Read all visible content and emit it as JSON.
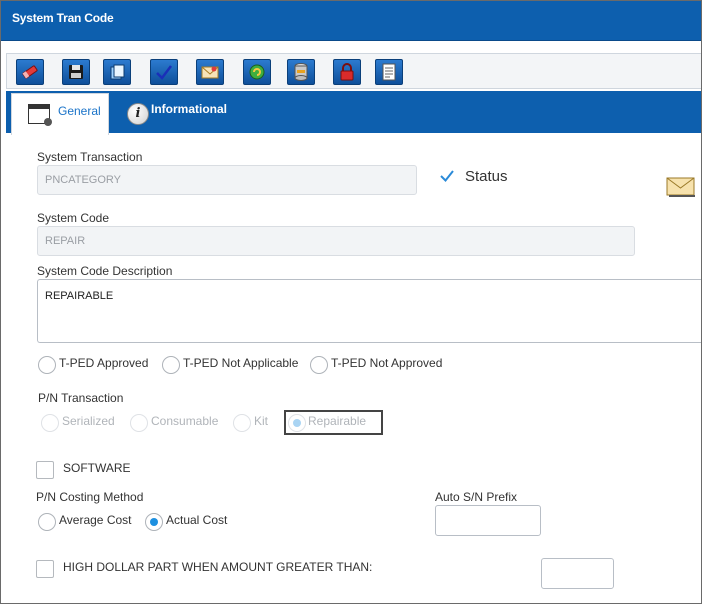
{
  "window": {
    "title": "System Tran Code"
  },
  "toolbar": {
    "buttons": [
      {
        "name": "eraser-icon"
      },
      {
        "name": "save-icon"
      },
      {
        "name": "copy-icon"
      },
      {
        "name": "checkmark-icon"
      },
      {
        "name": "mail-icon"
      },
      {
        "name": "refresh-icon"
      },
      {
        "name": "database-icon"
      },
      {
        "name": "lock-icon"
      },
      {
        "name": "report-icon"
      }
    ]
  },
  "tabs": [
    {
      "label": "General",
      "active": true
    },
    {
      "label": "Informational",
      "active": false
    }
  ],
  "form": {
    "system_transaction": {
      "label": "System Transaction",
      "value": "PNCATEGORY"
    },
    "status": {
      "label": "Status",
      "checked": true
    },
    "system_code": {
      "label": "System Code",
      "value": "REPAIR"
    },
    "system_code_description": {
      "label": "System Code Description",
      "value": "REPAIRABLE"
    },
    "tped": {
      "options": [
        {
          "label": "T-PED Approved",
          "selected": false
        },
        {
          "label": "T-PED Not Applicable",
          "selected": false
        },
        {
          "label": "T-PED Not Approved",
          "selected": false
        }
      ]
    },
    "pn_transaction": {
      "label": "P/N Transaction",
      "options": [
        {
          "label": "Serialized",
          "selected": false
        },
        {
          "label": "Consumable",
          "selected": false
        },
        {
          "label": "Kit",
          "selected": false
        },
        {
          "label": "Repairable",
          "selected": true
        }
      ]
    },
    "software": {
      "label": "SOFTWARE",
      "checked": false
    },
    "pn_costing_method": {
      "label": "P/N Costing Method",
      "options": [
        {
          "label": "Average Cost",
          "selected": false
        },
        {
          "label": "Actual Cost",
          "selected": true
        }
      ]
    },
    "auto_sn_prefix": {
      "label": "Auto S/N Prefix",
      "value": ""
    },
    "high_dollar": {
      "label": "HIGH DOLLAR PART WHEN AMOUNT GREATER THAN:",
      "checked": false,
      "value": ""
    }
  },
  "colors": {
    "header": "#0d5fae",
    "accent": "#1e90e0"
  }
}
